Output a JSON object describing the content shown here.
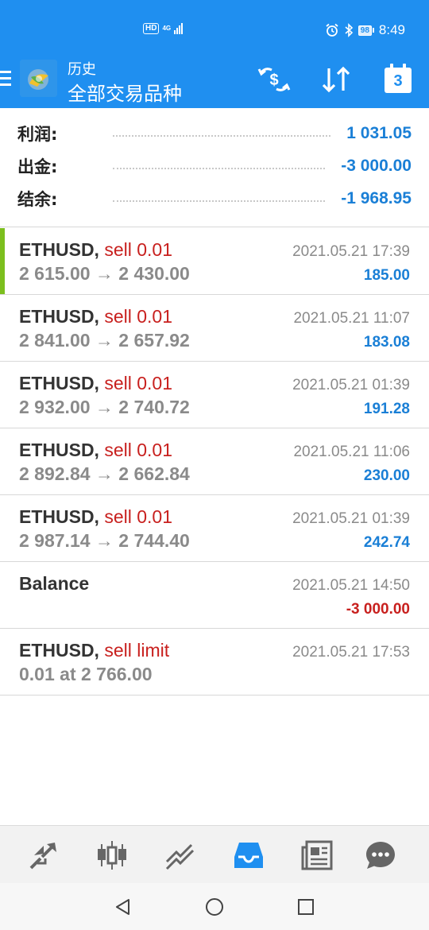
{
  "status_bar": {
    "hd": "HD",
    "network": "4G",
    "battery": "98",
    "time": "8:49"
  },
  "header": {
    "subtitle": "历史",
    "title": "全部交易品种",
    "calendar_day": "3"
  },
  "summary": {
    "rows": [
      {
        "label": "利润:",
        "value": "1 031.05"
      },
      {
        "label": "出金:",
        "value": "-3 000.00"
      },
      {
        "label": "结余:",
        "value": "-1 968.95"
      }
    ]
  },
  "deals": [
    {
      "symbol": "ETHUSD,",
      "type": "sell 0.01",
      "prices": "2 615.00 → 2 430.00",
      "time": "2021.05.21 17:39",
      "profit": "185.00"
    },
    {
      "symbol": "ETHUSD,",
      "type": "sell 0.01",
      "prices": "2 841.00 → 2 657.92",
      "time": "2021.05.21 11:07",
      "profit": "183.08"
    },
    {
      "symbol": "ETHUSD,",
      "type": "sell 0.01",
      "prices": "2 932.00 → 2 740.72",
      "time": "2021.05.21 01:39",
      "profit": "191.28"
    },
    {
      "symbol": "ETHUSD,",
      "type": "sell 0.01",
      "prices": "2 892.84 → 2 662.84",
      "time": "2021.05.21 11:06",
      "profit": "230.00"
    },
    {
      "symbol": "ETHUSD,",
      "type": "sell 0.01",
      "prices": "2 987.14 → 2 744.40",
      "time": "2021.05.21 01:39",
      "profit": "242.74"
    },
    {
      "symbol": "Balance",
      "type": "",
      "prices": "",
      "time": "2021.05.21 14:50",
      "profit": "-3 000.00"
    },
    {
      "symbol": "ETHUSD,",
      "type": "sell limit",
      "prices": "0.01 at 2 766.00",
      "time": "2021.05.21 17:53",
      "profit": ""
    }
  ],
  "bottom_nav": [
    {
      "icon": "quotes-icon"
    },
    {
      "icon": "chart-icon"
    },
    {
      "icon": "trade-icon"
    },
    {
      "icon": "history-icon",
      "active": true
    },
    {
      "icon": "news-icon"
    },
    {
      "icon": "messages-icon"
    }
  ],
  "colors": {
    "accent": "#1f8ff0",
    "profit_blue": "#1a7fd6",
    "loss_red": "#c8201e",
    "active_marker": "#7cbf1e"
  }
}
